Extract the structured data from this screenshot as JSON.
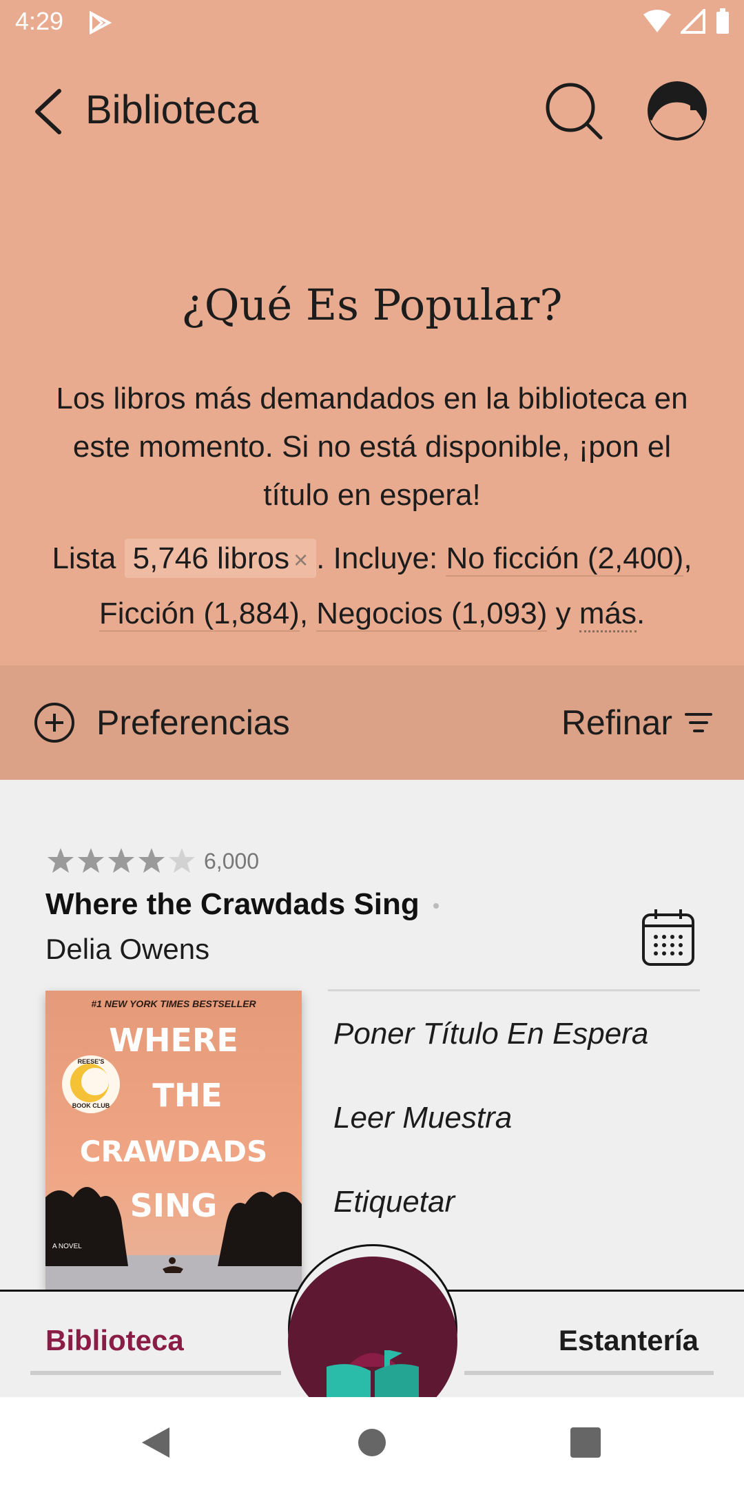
{
  "status_bar": {
    "time": "4:29"
  },
  "app_bar": {
    "title": "Biblioteca"
  },
  "hero": {
    "title": "¿Qué Es Popular?",
    "description": "Los libros más demandados en la biblioteca en este momento. Si no está disponible, ¡pon el título en espera!",
    "list_prefix": "Lista",
    "list_chip": "5,746 libros",
    "chip_close": "×",
    "includes_prefix": ". Incluye:",
    "categories": [
      {
        "label": "No ficción (2,400)"
      },
      {
        "label": "Ficción (1,884)"
      },
      {
        "label": "Negocios (1,093)"
      }
    ],
    "and_text": "y",
    "more_link": "más"
  },
  "filters": {
    "preferences_label": "Preferencias",
    "refine_label": "Refinar"
  },
  "book": {
    "rating": 4.5,
    "rating_max": 5,
    "rating_count": "6,000",
    "title": "Where the Crawdads Sing",
    "author": "Delia Owens",
    "cover": {
      "banner": "#1 NEW YORK TIMES BESTSELLER",
      "lines": [
        "WHERE",
        "THE",
        "CRAWDADS",
        "SING"
      ],
      "badge_top": "REESE'S",
      "badge_bottom": "BOOK CLUB",
      "footer": "A NOVEL"
    },
    "actions": [
      {
        "label": "Poner Título En Espera"
      },
      {
        "label": "Leer Muestra"
      },
      {
        "label": "Etiquetar"
      }
    ]
  },
  "bottom_nav": {
    "left_label": "Biblioteca",
    "right_label": "Estantería"
  },
  "colors": {
    "header_bg": "#e9ab8f",
    "prefs_bg": "#dca287",
    "accent": "#8a1d45",
    "fab": "#5e1831",
    "book_teal": "#2bbba9"
  }
}
